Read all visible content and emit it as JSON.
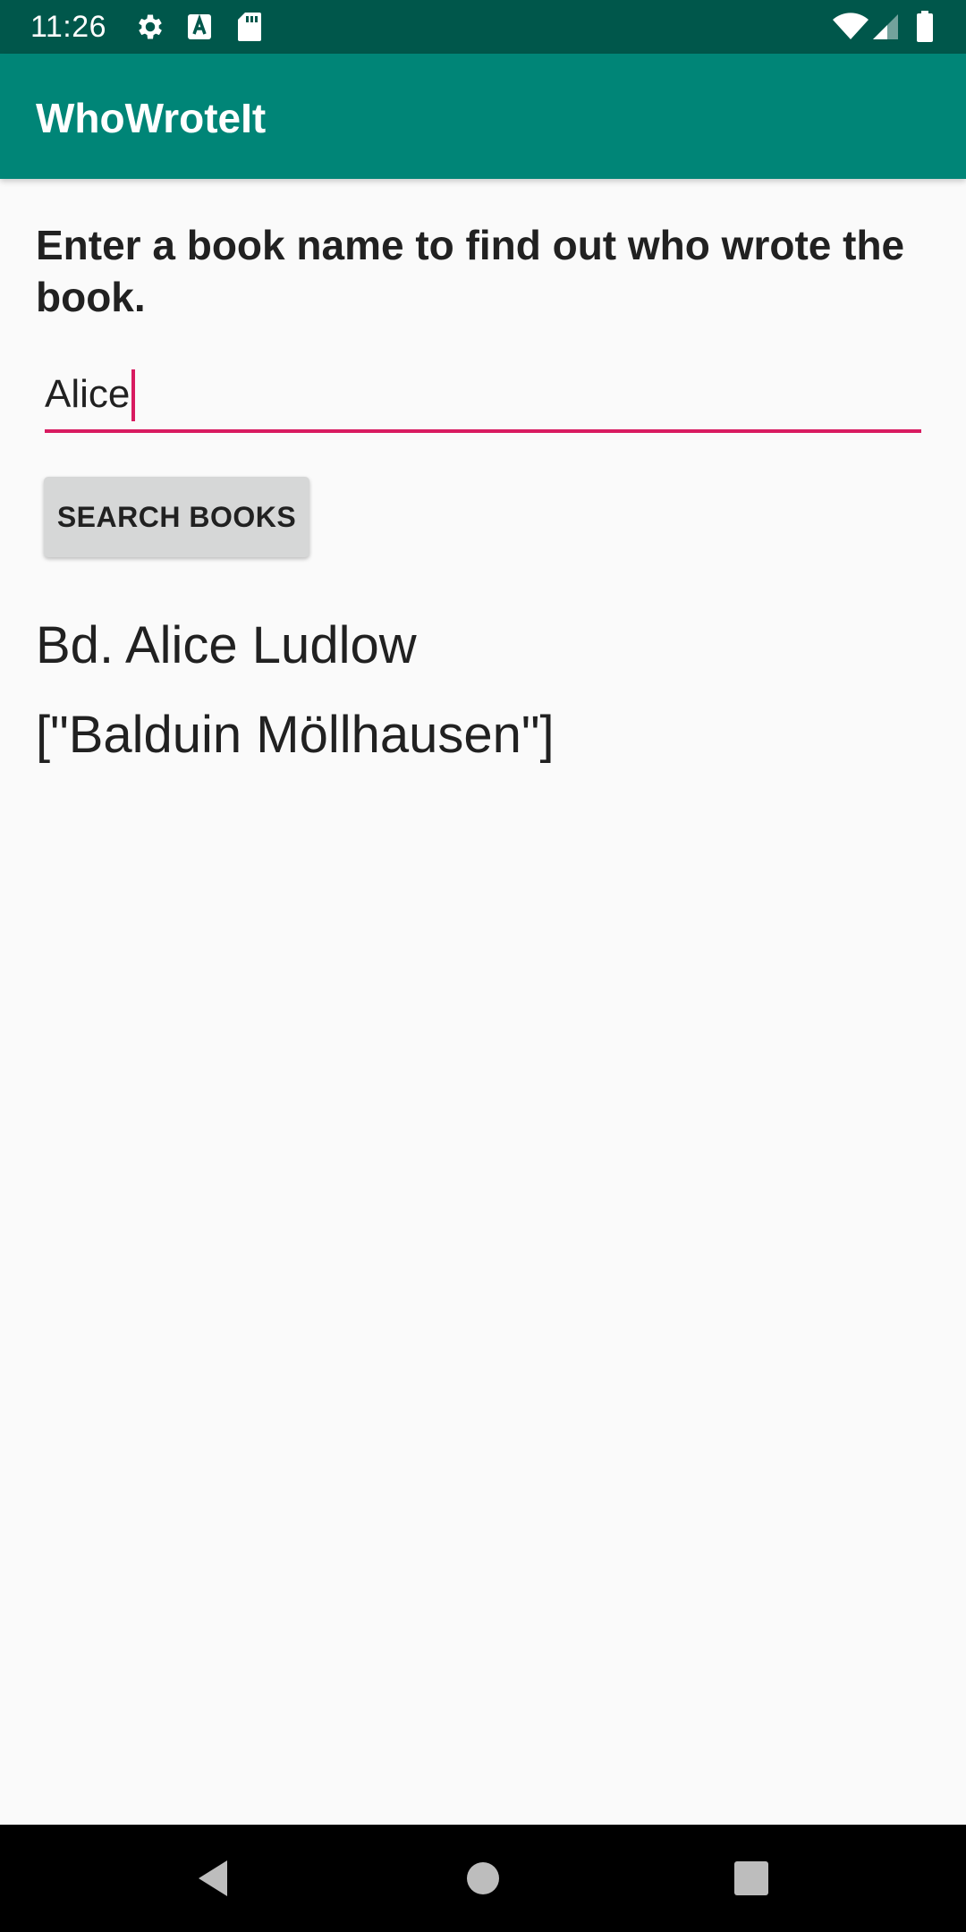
{
  "status_bar": {
    "time": "11:26",
    "icons_left": [
      "settings-icon",
      "accessibility-a-icon",
      "sd-card-icon"
    ],
    "icons_right": [
      "wifi-icon",
      "cell-signal-icon",
      "battery-icon"
    ],
    "background": "#00574b"
  },
  "app_bar": {
    "title": "WhoWroteIt",
    "background": "#008577"
  },
  "main": {
    "instructions": "Enter a book name to find out who wrote the book.",
    "search": {
      "value": "Alice",
      "accent": "#d81b60"
    },
    "search_button_label": "SEARCH BOOKS",
    "result": {
      "title": "Bd. Alice Ludlow",
      "authors": "[\"Balduin Möllhausen\"]"
    }
  },
  "nav_bar": {
    "buttons": [
      "back-icon",
      "home-icon",
      "recents-icon"
    ]
  }
}
